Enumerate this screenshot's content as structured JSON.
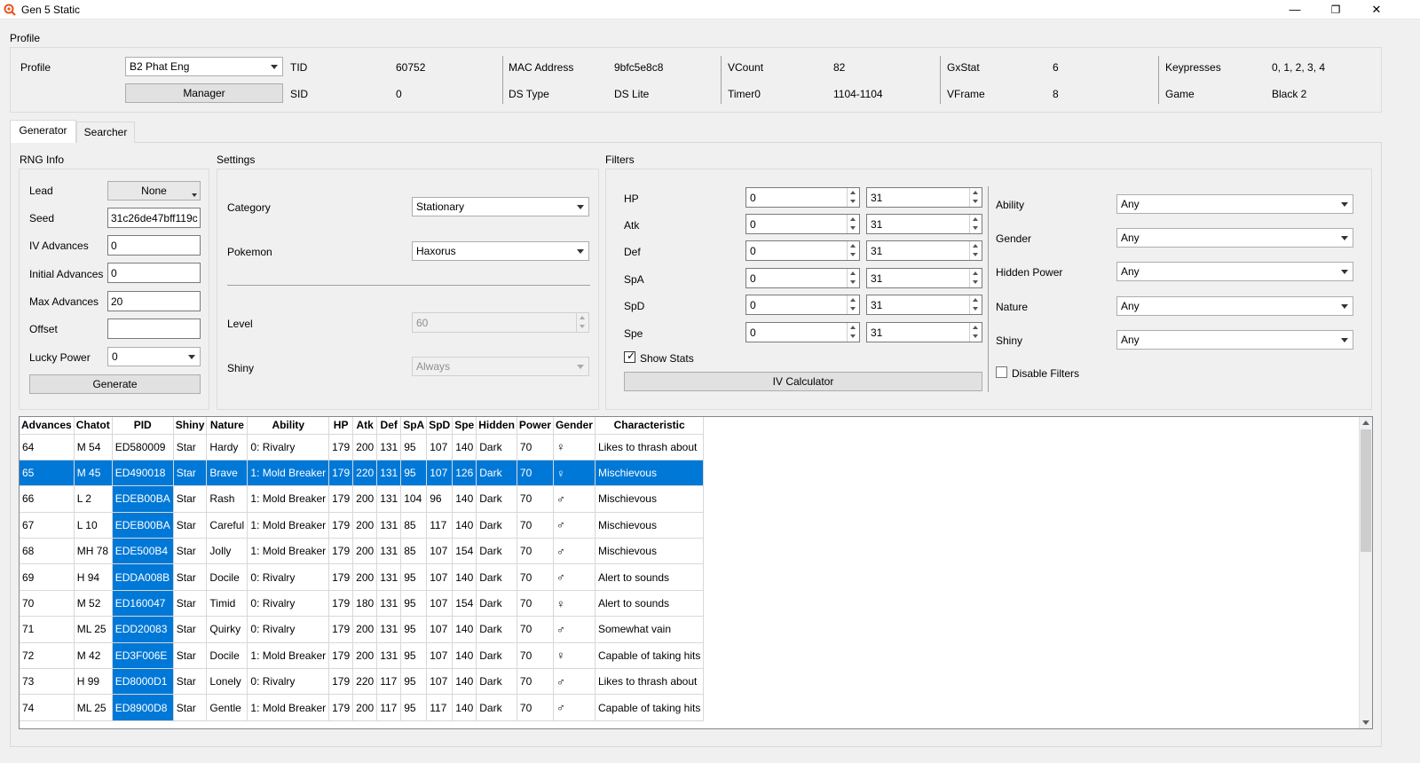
{
  "window": {
    "title": "Gen 5 Static",
    "minimize": "—",
    "restore": "❐",
    "close": "✕"
  },
  "profile": {
    "section_label": "Profile",
    "profile_label": "Profile",
    "profile_value": "B2 Phat Eng",
    "manager_label": "Manager",
    "fields": {
      "tid_label": "TID",
      "tid_value": "60752",
      "sid_label": "SID",
      "sid_value": "0",
      "mac_label": "MAC Address",
      "mac_value": "9bfc5e8c8",
      "dstype_label": "DS Type",
      "dstype_value": "DS Lite",
      "vcount_label": "VCount",
      "vcount_value": "82",
      "timer0_label": "Timer0",
      "timer0_value": "1104-1104",
      "gxstat_label": "GxStat",
      "gxstat_value": "6",
      "vframe_label": "VFrame",
      "vframe_value": "8",
      "keypresses_label": "Keypresses",
      "keypresses_value": "0, 1, 2, 3, 4",
      "game_label": "Game",
      "game_value": "Black 2"
    }
  },
  "tabs": [
    {
      "label": "Generator",
      "active": true
    },
    {
      "label": "Searcher",
      "active": false
    }
  ],
  "rng_info": {
    "section_label": "RNG Info",
    "lead_label": "Lead",
    "lead_value": "None",
    "seed_label": "Seed",
    "seed_value": "31c26de47bff119c",
    "iv_adv_label": "IV Advances",
    "iv_adv_value": "0",
    "init_adv_label": "Initial Advances",
    "init_adv_value": "0",
    "max_adv_label": "Max Advances",
    "max_adv_value": "20",
    "offset_label": "Offset",
    "offset_value": "",
    "lucky_label": "Lucky Power",
    "lucky_value": "0",
    "generate_label": "Generate"
  },
  "settings": {
    "section_label": "Settings",
    "category_label": "Category",
    "category_value": "Stationary",
    "pokemon_label": "Pokemon",
    "pokemon_value": "Haxorus",
    "level_label": "Level",
    "level_value": "60",
    "shiny_label": "Shiny",
    "shiny_value": "Always"
  },
  "filters": {
    "section_label": "Filters",
    "ivs": [
      {
        "stat": "HP",
        "min": "0",
        "max": "31"
      },
      {
        "stat": "Atk",
        "min": "0",
        "max": "31"
      },
      {
        "stat": "Def",
        "min": "0",
        "max": "31"
      },
      {
        "stat": "SpA",
        "min": "0",
        "max": "31"
      },
      {
        "stat": "SpD",
        "min": "0",
        "max": "31"
      },
      {
        "stat": "Spe",
        "min": "0",
        "max": "31"
      }
    ],
    "show_stats_label": "Show Stats",
    "show_stats_checked": true,
    "iv_calc_label": "IV Calculator",
    "ability_label": "Ability",
    "ability_value": "Any",
    "gender_label": "Gender",
    "gender_value": "Any",
    "hidden_power_label": "Hidden Power",
    "hidden_power_value": "Any",
    "nature_label": "Nature",
    "nature_value": "Any",
    "shiny_label": "Shiny",
    "shiny_value": "Any",
    "disable_filters_label": "Disable Filters",
    "disable_filters_checked": false
  },
  "results": {
    "columns": [
      "Advances",
      "Chatot",
      "PID",
      "Shiny",
      "Nature",
      "Ability",
      "HP",
      "Atk",
      "Def",
      "SpA",
      "SpD",
      "Spe",
      "Hidden",
      "Power",
      "Gender",
      "Characteristic"
    ],
    "selected_row": 1,
    "rows": [
      [
        "64",
        "M 54",
        "ED580009",
        "Star",
        "Hardy",
        "0: Rivalry",
        "179",
        "200",
        "131",
        "95",
        "107",
        "140",
        "Dark",
        "70",
        "♀",
        "Likes to thrash about"
      ],
      [
        "65",
        "M 45",
        "ED490018",
        "Star",
        "Brave",
        "1: Mold Breaker",
        "179",
        "220",
        "131",
        "95",
        "107",
        "126",
        "Dark",
        "70",
        "♀",
        "Mischievous"
      ],
      [
        "66",
        "L 2",
        "EDEB00BA",
        "Star",
        "Rash",
        "1: Mold Breaker",
        "179",
        "200",
        "131",
        "104",
        "96",
        "140",
        "Dark",
        "70",
        "♂",
        "Mischievous"
      ],
      [
        "67",
        "L 10",
        "EDEB00BA",
        "Star",
        "Careful",
        "1: Mold Breaker",
        "179",
        "200",
        "131",
        "85",
        "117",
        "140",
        "Dark",
        "70",
        "♂",
        "Mischievous"
      ],
      [
        "68",
        "MH 78",
        "EDE500B4",
        "Star",
        "Jolly",
        "1: Mold Breaker",
        "179",
        "200",
        "131",
        "85",
        "107",
        "154",
        "Dark",
        "70",
        "♂",
        "Mischievous"
      ],
      [
        "69",
        "H 94",
        "EDDA008B",
        "Star",
        "Docile",
        "0: Rivalry",
        "179",
        "200",
        "131",
        "95",
        "107",
        "140",
        "Dark",
        "70",
        "♂",
        "Alert to sounds"
      ],
      [
        "70",
        "M 52",
        "ED160047",
        "Star",
        "Timid",
        "0: Rivalry",
        "179",
        "180",
        "131",
        "95",
        "107",
        "154",
        "Dark",
        "70",
        "♀",
        "Alert to sounds"
      ],
      [
        "71",
        "ML 25",
        "EDD20083",
        "Star",
        "Quirky",
        "0: Rivalry",
        "179",
        "200",
        "131",
        "95",
        "107",
        "140",
        "Dark",
        "70",
        "♂",
        "Somewhat vain"
      ],
      [
        "72",
        "M 42",
        "ED3F006E",
        "Star",
        "Docile",
        "1: Mold Breaker",
        "179",
        "200",
        "131",
        "95",
        "107",
        "140",
        "Dark",
        "70",
        "♀",
        "Capable of taking hits"
      ],
      [
        "73",
        "H 99",
        "ED8000D1",
        "Star",
        "Lonely",
        "0: Rivalry",
        "179",
        "220",
        "117",
        "95",
        "107",
        "140",
        "Dark",
        "70",
        "♂",
        "Likes to thrash about"
      ],
      [
        "74",
        "ML 25",
        "ED8900D8",
        "Star",
        "Gentle",
        "1: Mold Breaker",
        "179",
        "200",
        "117",
        "95",
        "117",
        "140",
        "Dark",
        "70",
        "♂",
        "Capable of taking hits"
      ]
    ]
  },
  "colors": {
    "selection": "#0078d7",
    "app_icon": "#e8541c"
  }
}
